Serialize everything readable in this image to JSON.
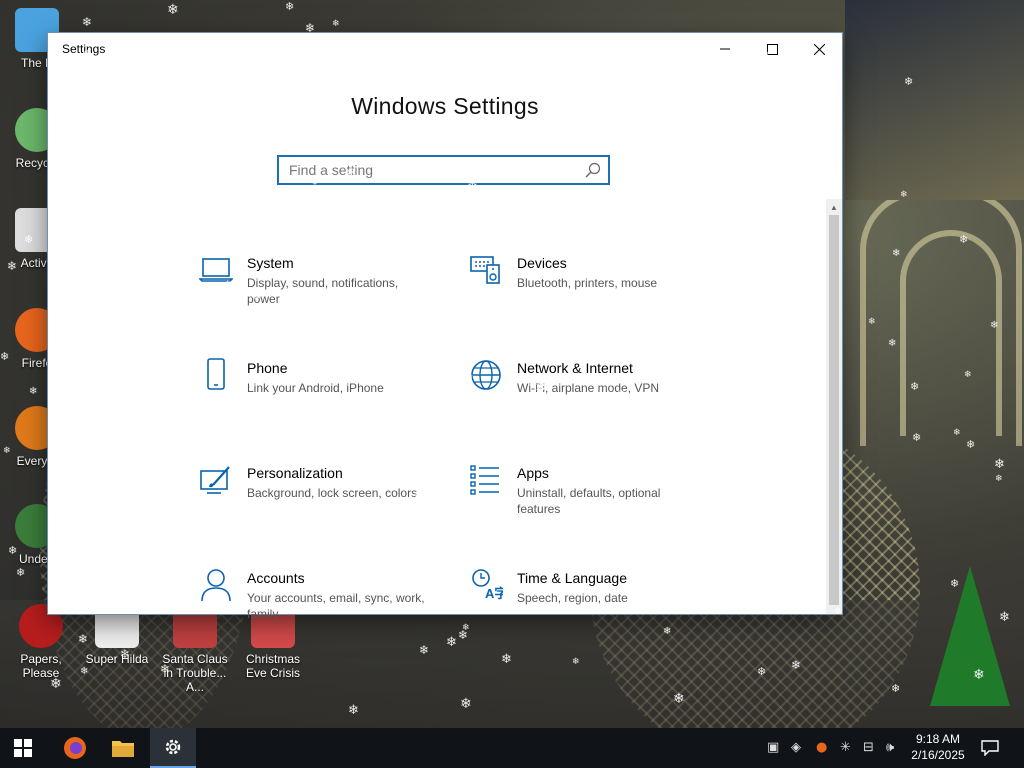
{
  "desktop": {
    "icons": [
      {
        "label": "The B",
        "color": "#4aa3df"
      },
      {
        "label": "Recycle",
        "color": "#6bb86b"
      },
      {
        "label": "Activa",
        "color": "#dddddd"
      },
      {
        "label": "Firefo",
        "color": "#e8651c"
      },
      {
        "label": "Everyth",
        "color": "#e07a1a"
      },
      {
        "label": "Undert",
        "color": "#3b7d3b"
      },
      {
        "label": "Papers, Please",
        "color": "#b81d1d"
      },
      {
        "label": "Super Hilda",
        "color": "#eeeeee"
      },
      {
        "label": "Santa Claus in Trouble... A...",
        "color": "#c04040"
      },
      {
        "label": "Christmas Eve Crisis",
        "color": "#d44a4a"
      }
    ]
  },
  "window": {
    "title": "Settings",
    "heading": "Windows Settings",
    "search_placeholder": "Find a setting",
    "items": [
      {
        "name": "System",
        "desc": "Display, sound, notifications, power",
        "icon": "laptop-icon"
      },
      {
        "name": "Devices",
        "desc": "Bluetooth, printers, mouse",
        "icon": "keyboard-speaker-icon"
      },
      {
        "name": "Phone",
        "desc": "Link your Android, iPhone",
        "icon": "phone-icon"
      },
      {
        "name": "Network & Internet",
        "desc": "Wi-Fi, airplane mode, VPN",
        "icon": "globe-icon"
      },
      {
        "name": "Personalization",
        "desc": "Background, lock screen, colors",
        "icon": "paintbrush-icon"
      },
      {
        "name": "Apps",
        "desc": "Uninstall, defaults, optional features",
        "icon": "apps-list-icon"
      },
      {
        "name": "Accounts",
        "desc": "Your accounts, email, sync, work, family",
        "icon": "person-icon"
      },
      {
        "name": "Time & Language",
        "desc": "Speech, region, date",
        "icon": "time-language-icon"
      }
    ]
  },
  "taskbar": {
    "time": "9:18 AM",
    "date": "2/16/2025"
  },
  "colors": {
    "accent": "#1f6fb4",
    "icon_blue": "#0a64ad"
  }
}
